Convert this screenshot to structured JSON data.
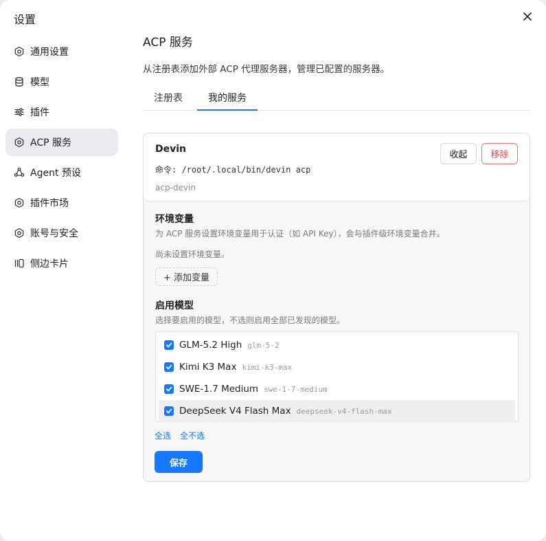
{
  "dialog": {
    "title": "设置"
  },
  "sidebar": {
    "items": [
      {
        "label": "通用设置",
        "icon": "gear-icon",
        "active": false
      },
      {
        "label": "模型",
        "icon": "database-icon",
        "active": false
      },
      {
        "label": "插件",
        "icon": "sliders-icon",
        "active": false
      },
      {
        "label": "ACP 服务",
        "icon": "gear-icon",
        "active": true
      },
      {
        "label": "Agent 预设",
        "icon": "agent-icon",
        "active": false
      },
      {
        "label": "插件市场",
        "icon": "gear-icon",
        "active": false
      },
      {
        "label": "账号与安全",
        "icon": "gear-icon",
        "active": false
      },
      {
        "label": "侧边卡片",
        "icon": "side-panel-icon",
        "active": false
      }
    ]
  },
  "main": {
    "title": "ACP 服务",
    "description": "从注册表添加外部 ACP 代理服务器，管理已配置的服务器。",
    "tabs": [
      {
        "label": "注册表",
        "active": false
      },
      {
        "label": "我的服务",
        "active": true
      }
    ]
  },
  "service": {
    "name": "Devin",
    "command": "命令: /root/.local/bin/devin acp",
    "id": "acp-devin",
    "collapse_label": "收起",
    "remove_label": "移除"
  },
  "env": {
    "title": "环境变量",
    "description": "为 ACP 服务设置环境变量用于认证（如 API Key），会与插件级环境变量合并。",
    "empty_text": "尚未设置环境变量。",
    "add_label": "+ 添加变量"
  },
  "models": {
    "title": "启用模型",
    "description": "选择要启用的模型，不选则启用全部已发现的模型。",
    "items": [
      {
        "name": "GLM-5.2 High",
        "id": "glm-5-2",
        "checked": true
      },
      {
        "name": "Kimi K3 Max",
        "id": "kimi-k3-max",
        "checked": true
      },
      {
        "name": "SWE-1.7 Medium",
        "id": "swe-1-7-medium",
        "checked": true
      },
      {
        "name": "DeepSeek V4 Flash Max",
        "id": "deepseek-v4-flash-max",
        "checked": true
      }
    ],
    "select_all_label": "全选",
    "select_none_label": "全不选",
    "save_label": "保存"
  },
  "colors": {
    "accent": "#1677ff",
    "danger": "#e5484d",
    "active_nav_bg": "#e9ebef"
  }
}
